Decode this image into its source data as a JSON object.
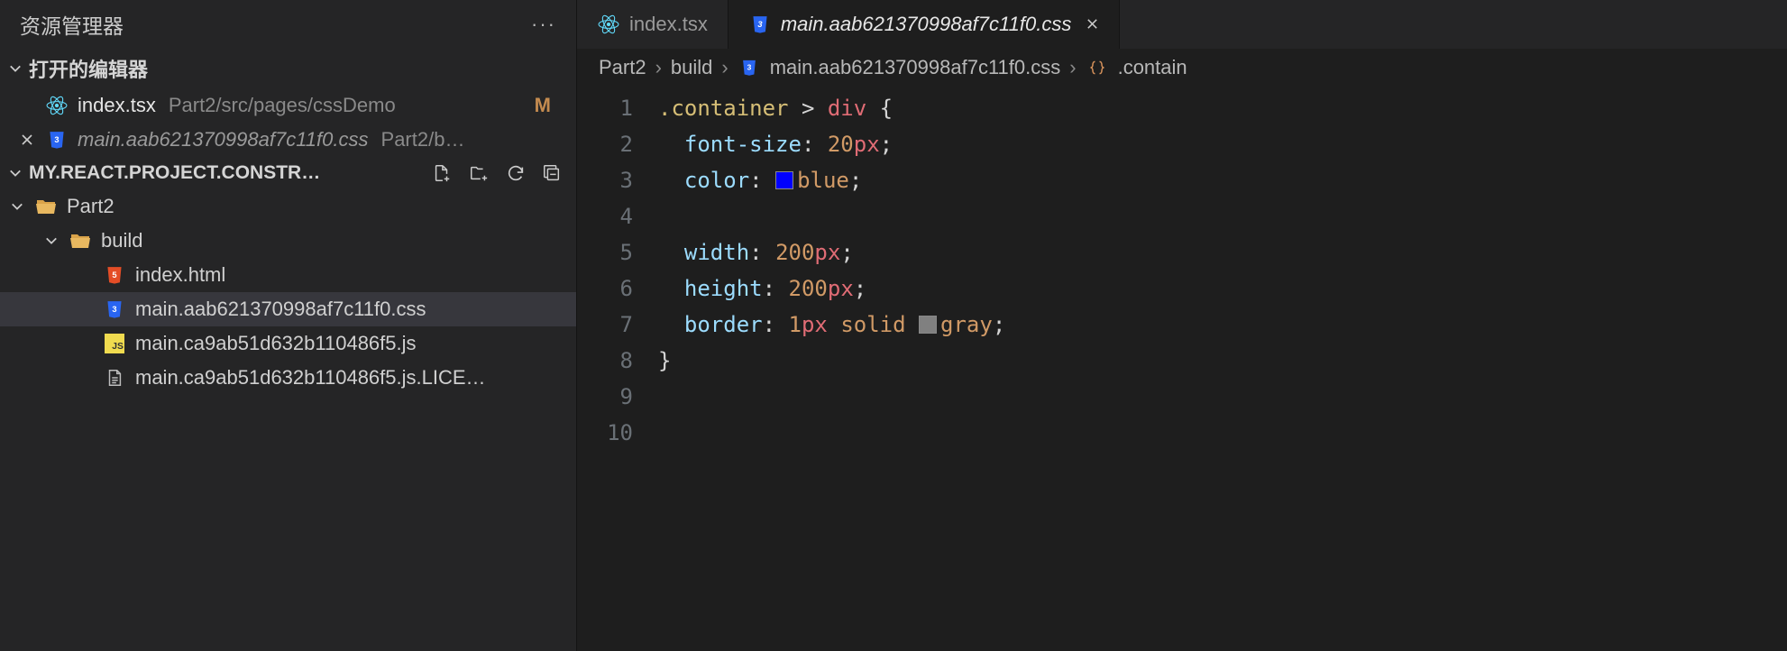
{
  "explorer": {
    "title": "资源管理器",
    "open_editors_label": "打开的编辑器",
    "project_label": "MY.REACT.PROJECT.CONSTR…",
    "editors": [
      {
        "name": "index.tsx",
        "path": "Part2/src/pages/cssDemo",
        "modified": "M",
        "icon": "react"
      },
      {
        "name": "main.aab621370998af7c11f0.css",
        "path": "Part2/b…",
        "icon": "css",
        "closeable": true,
        "dim": true
      }
    ],
    "tree": [
      {
        "depth": 0,
        "kind": "folder-open",
        "label": "Part2",
        "chev": "down"
      },
      {
        "depth": 1,
        "kind": "folder-open",
        "label": "build",
        "chev": "down"
      },
      {
        "depth": 2,
        "kind": "html",
        "label": "index.html"
      },
      {
        "depth": 2,
        "kind": "css",
        "label": "main.aab621370998af7c11f0.css",
        "selected": true
      },
      {
        "depth": 2,
        "kind": "js",
        "label": "main.ca9ab51d632b110486f5.js"
      },
      {
        "depth": 2,
        "kind": "txt",
        "label": "main.ca9ab51d632b110486f5.js.LICE…"
      }
    ]
  },
  "tabs": [
    {
      "label": "index.tsx",
      "icon": "react",
      "active": false
    },
    {
      "label": "main.aab621370998af7c11f0.css",
      "icon": "css",
      "active": true,
      "closeable": true
    }
  ],
  "breadcrumb": {
    "parts": [
      "Part2",
      "build"
    ],
    "file": "main.aab621370998af7c11f0.css",
    "symbol": ".contain"
  },
  "code": {
    "lines": [
      {
        "n": 1,
        "tokens": [
          {
            "t": "sel",
            "v": ".container"
          },
          {
            "t": "op",
            "v": " > "
          },
          {
            "t": "tag",
            "v": "div"
          },
          {
            "t": "op",
            "v": " {"
          }
        ]
      },
      {
        "n": 2,
        "tokens": [
          {
            "t": "op",
            "v": "  "
          },
          {
            "t": "prop",
            "v": "font-size"
          },
          {
            "t": "op",
            "v": ": "
          },
          {
            "t": "num",
            "v": "20"
          },
          {
            "t": "unit",
            "v": "px"
          },
          {
            "t": "op",
            "v": ";"
          }
        ]
      },
      {
        "n": 3,
        "tokens": [
          {
            "t": "op",
            "v": "  "
          },
          {
            "t": "prop",
            "v": "color"
          },
          {
            "t": "op",
            "v": ": "
          },
          {
            "t": "swatch",
            "v": "#0000ff"
          },
          {
            "t": "const",
            "v": "blue"
          },
          {
            "t": "op",
            "v": ";"
          }
        ]
      },
      {
        "n": 4,
        "tokens": []
      },
      {
        "n": 5,
        "tokens": [
          {
            "t": "op",
            "v": "  "
          },
          {
            "t": "prop",
            "v": "width"
          },
          {
            "t": "op",
            "v": ": "
          },
          {
            "t": "num",
            "v": "200"
          },
          {
            "t": "unit",
            "v": "px"
          },
          {
            "t": "op",
            "v": ";"
          }
        ]
      },
      {
        "n": 6,
        "tokens": [
          {
            "t": "op",
            "v": "  "
          },
          {
            "t": "prop",
            "v": "height"
          },
          {
            "t": "op",
            "v": ": "
          },
          {
            "t": "num",
            "v": "200"
          },
          {
            "t": "unit",
            "v": "px"
          },
          {
            "t": "op",
            "v": ";"
          }
        ]
      },
      {
        "n": 7,
        "tokens": [
          {
            "t": "op",
            "v": "  "
          },
          {
            "t": "prop",
            "v": "border"
          },
          {
            "t": "op",
            "v": ": "
          },
          {
            "t": "num",
            "v": "1"
          },
          {
            "t": "unit",
            "v": "px"
          },
          {
            "t": "op",
            "v": " "
          },
          {
            "t": "const",
            "v": "solid"
          },
          {
            "t": "op",
            "v": " "
          },
          {
            "t": "swatch",
            "v": "#808080"
          },
          {
            "t": "const",
            "v": "gray"
          },
          {
            "t": "op",
            "v": ";"
          }
        ]
      },
      {
        "n": 8,
        "tokens": [
          {
            "t": "op",
            "v": "}"
          }
        ]
      },
      {
        "n": 9,
        "tokens": []
      },
      {
        "n": 10,
        "tokens": []
      }
    ]
  },
  "icons": {
    "react_color": "#61DAFB",
    "css_color": "#2965f1",
    "html_color": "#e44d26",
    "js_color": "#f0db4f"
  }
}
